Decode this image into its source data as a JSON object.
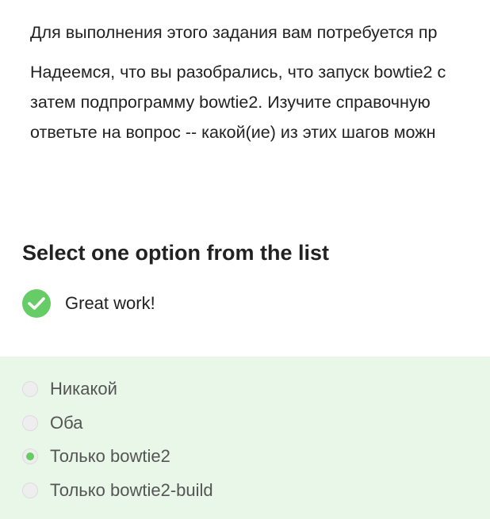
{
  "step": {
    "paragraph1": "Для выполнения этого задания вам потребуется пр",
    "paragraph2_lines": [
      "Надеемся, что вы разобрались, что запуск bowtie2 с",
      "затем подпрограмму bowtie2. Изучите справочную",
      "ответьте на вопрос -- какой(ие) из этих шагов можн"
    ]
  },
  "quiz": {
    "title": "Select one option from the list",
    "feedback": {
      "icon": "check-circle-icon",
      "text": "Great work!",
      "color": "#66cc66"
    },
    "options": [
      {
        "label": "Никакой",
        "selected": false
      },
      {
        "label": "Оба",
        "selected": false
      },
      {
        "label": "Только bowtie2",
        "selected": true
      },
      {
        "label": "Только bowtie2-build",
        "selected": false
      }
    ],
    "panel_color": "#e8f7e8"
  }
}
